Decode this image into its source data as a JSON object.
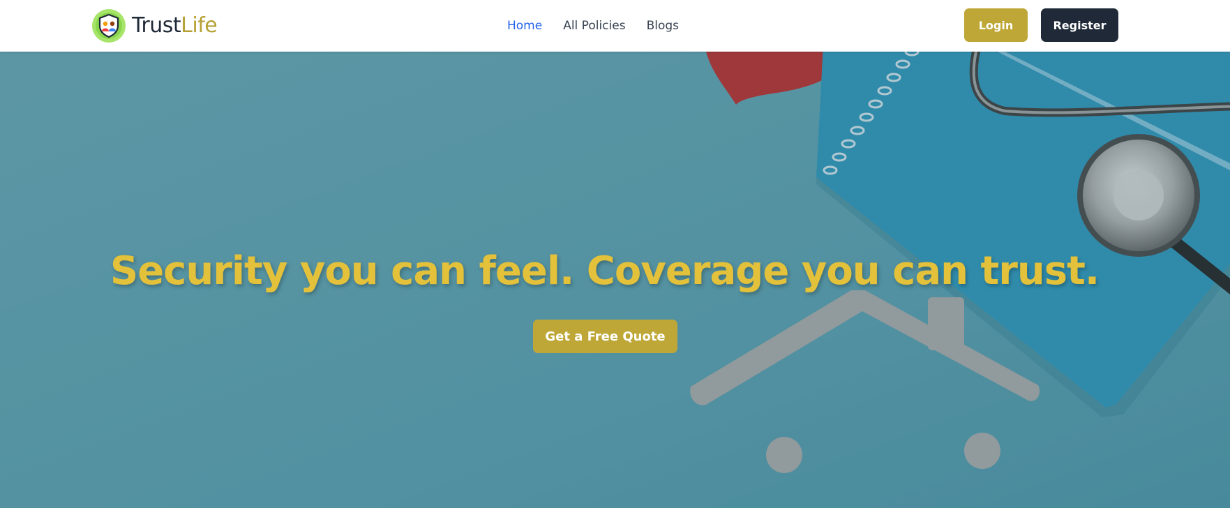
{
  "brand": {
    "name_part1": "Trust",
    "name_part2": "Life",
    "logo_icon": "shield-family-icon"
  },
  "nav": {
    "items": [
      {
        "label": "Home",
        "active": true
      },
      {
        "label": "All Policies",
        "active": false
      },
      {
        "label": "Blogs",
        "active": false
      }
    ]
  },
  "auth": {
    "login_label": "Login",
    "register_label": "Register"
  },
  "hero": {
    "headline": "Security you can feel. Coverage you can trust.",
    "cta_label": "Get a Free Quote",
    "background": "teal-desk-with-heart-notebook-stethoscope-and-paper-house"
  },
  "colors": {
    "accent_gold": "#bea737",
    "headline_gold": "#e3c13b",
    "dark": "#1f2937",
    "link_active": "#2563eb",
    "hero_teal": "#4f9aab"
  }
}
